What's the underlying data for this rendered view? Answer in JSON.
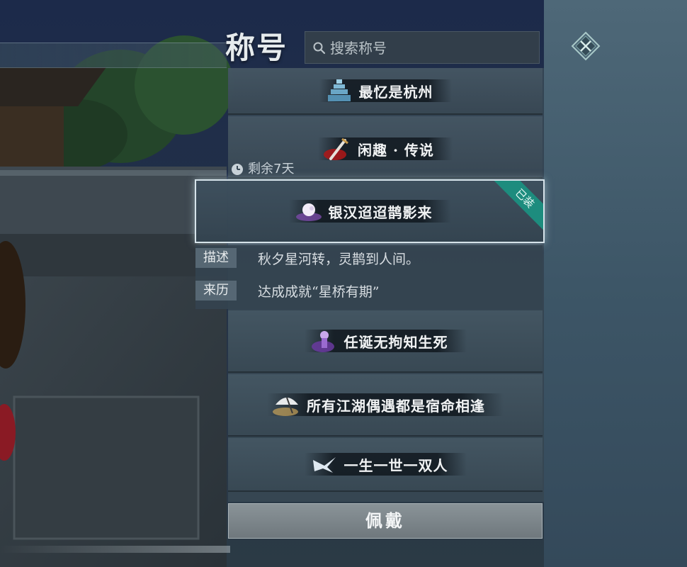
{
  "header": {
    "title": "称号",
    "search_placeholder": "搜索称号"
  },
  "titles": [
    {
      "label": "最忆是杭州",
      "icon": "pagoda-icon"
    },
    {
      "label": "闲趣 · 传说",
      "icon": "sword-icon"
    },
    {
      "label": "银汉迢迢鹊影来",
      "icon": "moon-icon",
      "selected": true,
      "badge": "已装",
      "remaining": "剩余7天"
    },
    {
      "label": "任诞无拘知生死",
      "icon": "purple-figure-icon"
    },
    {
      "label": "所有江湖偶遇都是宿命相逢",
      "icon": "umbrella-icon"
    },
    {
      "label": "一生一世一双人",
      "icon": "swallow-icon"
    }
  ],
  "detail": {
    "desc_label": "描述",
    "desc_text": "秋夕星河转，灵鹊到人间。",
    "origin_label": "来历",
    "origin_text": "达成成就“星桥有期”"
  },
  "actions": {
    "wear_label": "佩戴"
  },
  "colors": {
    "badge": "#1d8c7e",
    "selected_border": "#d6e3ea"
  }
}
